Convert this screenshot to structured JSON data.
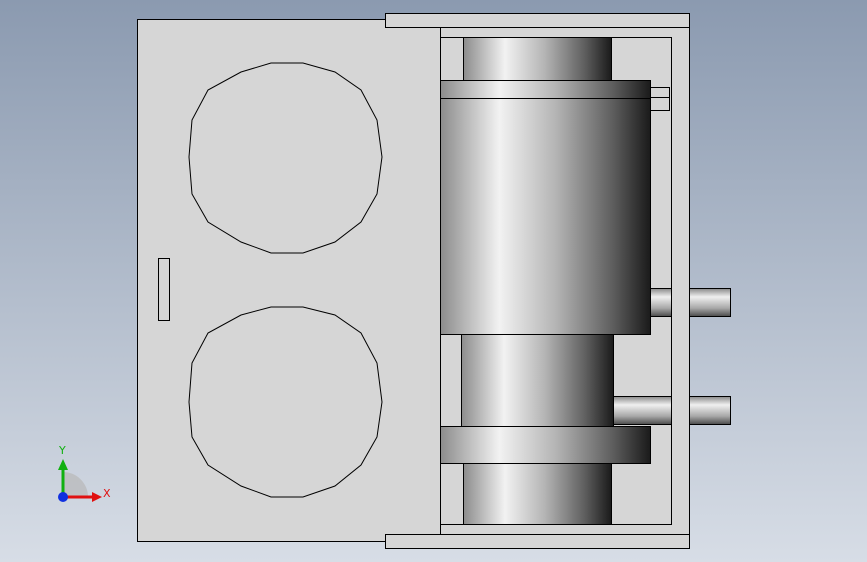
{
  "viewport": {
    "background_top": "#8b9ab0",
    "background_bottom": "#d7dde6",
    "part_fill": "#d6d6d6",
    "edge_color": "#000000"
  },
  "triad": {
    "x_label": "X",
    "y_label": "Y",
    "x_color": "#e01010",
    "y_color": "#10b010",
    "z_color": "#1030e0"
  }
}
